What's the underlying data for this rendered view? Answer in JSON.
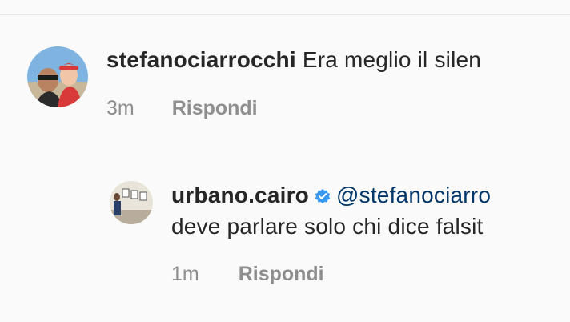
{
  "comments": [
    {
      "username": "stefanociarrocchi",
      "text": "Era meglio il silen",
      "time": "3m",
      "reply_label": "Rispondi"
    },
    {
      "username": "urbano.cairo",
      "verified": true,
      "mention": "@stefanociarro",
      "text_line2": "deve parlare solo chi dice falsit",
      "time": "1m",
      "reply_label": "Rispondi"
    }
  ],
  "colors": {
    "background": "#fafafa",
    "text": "#262626",
    "secondary": "#8e8e8e",
    "mention": "#00376b",
    "verified_badge": "#3897f0"
  },
  "icons": {
    "verified": "verified-badge-icon"
  }
}
